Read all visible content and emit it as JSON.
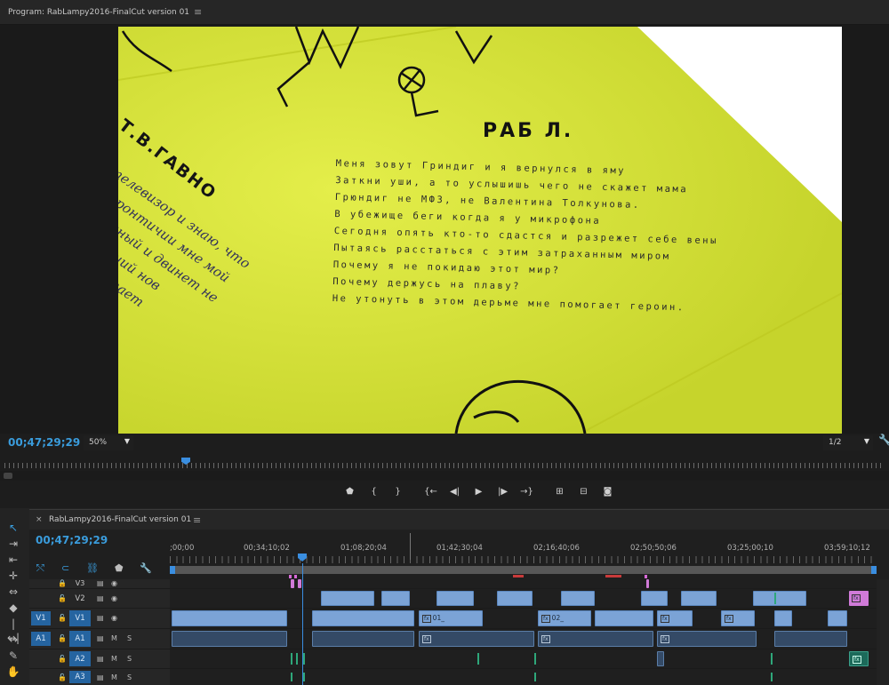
{
  "program_monitor": {
    "title": "Program: RabLampy2016-FinalCut version 01",
    "menu_icon": "≡",
    "timecode": "00;47;29;29",
    "zoom": "50%",
    "resolution": "1/2",
    "frame": {
      "title": "РАБ Л.",
      "side_text": "Т.В.ГАВНО",
      "lyrics": [
        "Меня зовут Гриндиг и я вернулся в яму",
        "Заткни уши, а то услышишь чего не скажет мама",
        "Грюндиг не МФ3, не Валентина Толкунова.",
        "В убежище беги когда я у микрофона",
        "Сегодня опять кто-то сдастся и разрежет себе вены",
        "Пытаясь расстаться с этим затраханным миром",
        "Почему я не покидаю этот мир?",
        "Почему держусь на плаву?",
        "Не утонуть в этом дерьме мне помогает героин."
      ],
      "script_lines": [
        "телевизор и знаю, что",
        "а фронтичии мне мой",
        "сделаный и двинет не",
        "их Ливший нов",
        "лев работает"
      ]
    },
    "transport": [
      "marker-icon",
      "in-icon",
      "out-icon",
      "go-in-icon",
      "step-back-icon",
      "play-icon",
      "step-forward-icon",
      "go-out-icon",
      "lift-icon",
      "extract-icon",
      "camera-icon"
    ]
  },
  "timeline": {
    "title": "RabLampy2016-FinalCut version 01",
    "menu_icon": "≡",
    "close_icon": "×",
    "timecode": "00;47;29;29",
    "ruler_labels": [
      ";00;00",
      "00;34;10;02",
      "01;08;20;04",
      "01;42;30;04",
      "02;16;40;06",
      "02;50;50;06",
      "03;25;00;10",
      "03;59;10;12"
    ],
    "tracks": [
      {
        "name": "V3",
        "source": "",
        "type": "video",
        "icons": [
          "film-icon",
          "eye-icon"
        ]
      },
      {
        "name": "V2",
        "source": "",
        "type": "video",
        "icons": [
          "film-icon",
          "eye-icon"
        ]
      },
      {
        "name": "V1",
        "source": "V1",
        "type": "video",
        "icons": [
          "film-icon",
          "eye-icon"
        ]
      },
      {
        "name": "A1",
        "source": "A1",
        "type": "audio",
        "icons": [
          "M",
          "S"
        ]
      },
      {
        "name": "A2",
        "source": "",
        "type": "audio",
        "icons": [
          "M",
          "S"
        ]
      },
      {
        "name": "A3",
        "source": "",
        "type": "audio",
        "icons": [
          "M",
          "S"
        ]
      }
    ],
    "clip_labels": [
      "01_",
      "02_"
    ],
    "fx_label": "fx"
  },
  "colors": {
    "accent": "#3a9cdc",
    "video_clip": "#7ba3d6",
    "audio_clip": "#344a66",
    "pink_clip": "#d07ad8",
    "frame_bg": "#d8e638"
  }
}
